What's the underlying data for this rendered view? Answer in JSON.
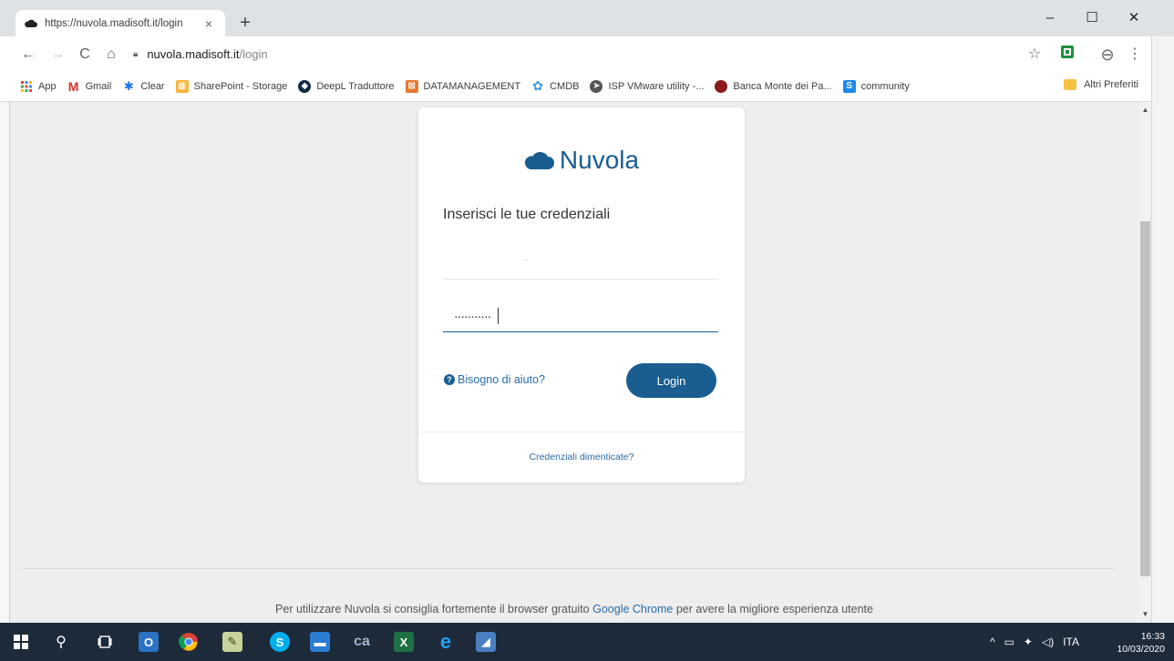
{
  "browser": {
    "tab_title": "https://nuvola.madisoft.it/login",
    "tab_close": "×",
    "new_tab": "+",
    "url_host": "nuvola.madisoft.it",
    "url_path": "/login",
    "window_controls": {
      "minimize": "–",
      "maximize": "☐",
      "close": "✕"
    },
    "nav": {
      "back": "←",
      "forward": "→",
      "reload": "C",
      "home": "⌂"
    },
    "toolbar_icons": {
      "star": "☆",
      "profile": "⊖",
      "menu": "⋮"
    }
  },
  "bookmarks": [
    {
      "label": "App",
      "icon": "apps-icon",
      "color": "#ea4335"
    },
    {
      "label": "Gmail",
      "icon": "gmail-icon",
      "color": "#d93025"
    },
    {
      "label": "Clear",
      "icon": "gear-icon",
      "color": "#1a73e8"
    },
    {
      "label": "SharePoint - Storage",
      "icon": "sharepoint-icon",
      "color": "#f6b43b"
    },
    {
      "label": "DeepL Traduttore",
      "icon": "deepl-icon",
      "color": "#0f2b46"
    },
    {
      "label": "DATAMANAGEMENT",
      "icon": "datamanagement-icon",
      "color": "#e8792f"
    },
    {
      "label": "CMDB",
      "icon": "cmdb-icon",
      "color": "#3b9bd8"
    },
    {
      "label": "ISP VMware utility -...",
      "icon": "vmware-icon",
      "color": "#555555"
    },
    {
      "label": "Banca Monte dei Pa...",
      "icon": "bank-icon",
      "color": "#8b1a1a"
    },
    {
      "label": "community",
      "icon": "sharepoint-community-icon",
      "color": "#1a8ae8"
    }
  ],
  "bookmarks_other": "Altri Preferiti",
  "login": {
    "brand": "Nuvola",
    "heading": "Inserisci le tue credenziali",
    "username_value": "·",
    "password_value": "···········",
    "help_link": "Bisogno di aiuto?",
    "login_button": "Login",
    "forgot_link": "Credenziali dimenticate?"
  },
  "footer": {
    "text_before": "Per utilizzare Nuvola si consiglia fortemente il browser gratuito ",
    "link": "Google Chrome",
    "text_after": " per avere la migliore esperienza utente"
  },
  "taskbar": {
    "language": "ITA",
    "time": "16:33",
    "date": "10/03/2020"
  },
  "colors": {
    "brand": "#1a5d90",
    "link": "#2a6ba6",
    "taskbar": "#1d2a3a"
  }
}
